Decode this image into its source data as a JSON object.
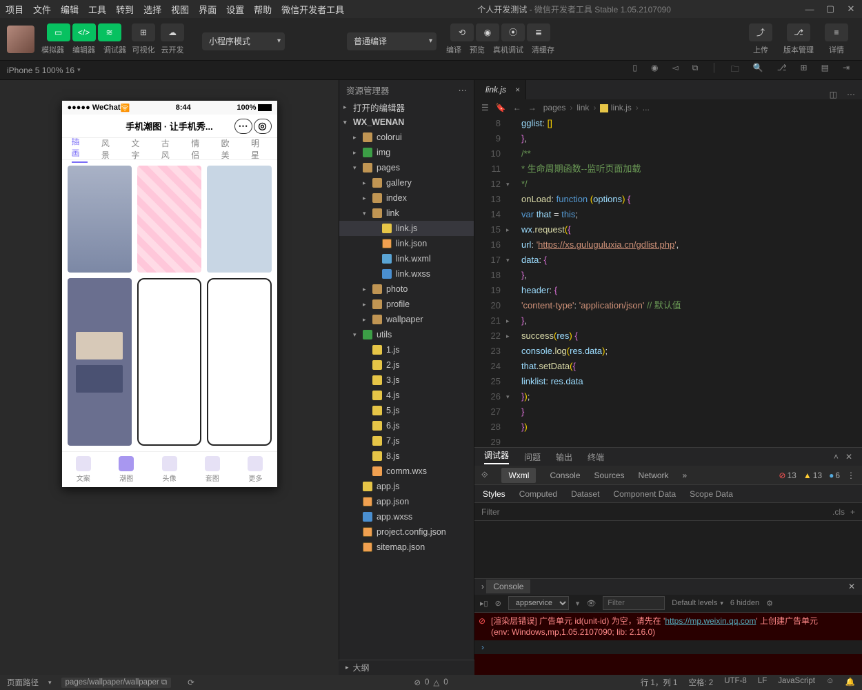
{
  "window": {
    "menus": [
      "项目",
      "文件",
      "编辑",
      "工具",
      "转到",
      "选择",
      "视图",
      "界面",
      "设置",
      "帮助",
      "微信开发者工具"
    ],
    "title_app": "个人开发测试",
    "title_sub": "- 微信开发者工具 Stable 1.05.2107090"
  },
  "toolbar": {
    "mode_labels": [
      "模拟器",
      "编辑器",
      "调试器"
    ],
    "vis_label": "可视化",
    "cloud_label": "云开发",
    "mode_select": "小程序模式",
    "compile_select": "普通编译",
    "action_labels": [
      "编译",
      "预览",
      "真机调试",
      "清缓存"
    ],
    "right_labels": [
      "上传",
      "版本管理",
      "详情"
    ]
  },
  "devbar": {
    "device": "iPhone 5 100% 16"
  },
  "sim": {
    "status": {
      "carrier": "●●●●● WeChat",
      "signal": "",
      "time": "8:44",
      "batt": "100%"
    },
    "title": "手机潮图 · 让手机秀...",
    "tabs": [
      "插画",
      "风景",
      "文字",
      "古风",
      "情侣",
      "欧美",
      "明星"
    ],
    "tabbar": [
      "文案",
      "潮图",
      "头像",
      "套图",
      "更多"
    ]
  },
  "explorer": {
    "header": "资源管理器",
    "sections": {
      "open": "打开的编辑器",
      "project": "WX_WENAN",
      "outline": "大纲"
    },
    "tree": [
      {
        "d": 1,
        "t": "colorui",
        "k": "dir"
      },
      {
        "d": 1,
        "t": "img",
        "k": "dirg"
      },
      {
        "d": 1,
        "t": "pages",
        "k": "dir",
        "open": true
      },
      {
        "d": 2,
        "t": "gallery",
        "k": "dir"
      },
      {
        "d": 2,
        "t": "index",
        "k": "dir"
      },
      {
        "d": 2,
        "t": "link",
        "k": "dir",
        "open": true
      },
      {
        "d": 3,
        "t": "link.js",
        "k": "js",
        "sel": true
      },
      {
        "d": 3,
        "t": "link.json",
        "k": "json"
      },
      {
        "d": 3,
        "t": "link.wxml",
        "k": "wxml"
      },
      {
        "d": 3,
        "t": "link.wxss",
        "k": "wxss"
      },
      {
        "d": 2,
        "t": "photo",
        "k": "dir"
      },
      {
        "d": 2,
        "t": "profile",
        "k": "dir"
      },
      {
        "d": 2,
        "t": "wallpaper",
        "k": "dir"
      },
      {
        "d": 1,
        "t": "utils",
        "k": "dirg",
        "open": true
      },
      {
        "d": 2,
        "t": "1.js",
        "k": "js"
      },
      {
        "d": 2,
        "t": "2.js",
        "k": "js"
      },
      {
        "d": 2,
        "t": "3.js",
        "k": "js"
      },
      {
        "d": 2,
        "t": "4.js",
        "k": "js"
      },
      {
        "d": 2,
        "t": "5.js",
        "k": "js"
      },
      {
        "d": 2,
        "t": "6.js",
        "k": "js"
      },
      {
        "d": 2,
        "t": "7.js",
        "k": "js"
      },
      {
        "d": 2,
        "t": "8.js",
        "k": "js"
      },
      {
        "d": 2,
        "t": "comm.wxs",
        "k": "wxs"
      },
      {
        "d": 1,
        "t": "app.js",
        "k": "js"
      },
      {
        "d": 1,
        "t": "app.json",
        "k": "json"
      },
      {
        "d": 1,
        "t": "app.wxss",
        "k": "wxss"
      },
      {
        "d": 1,
        "t": "project.config.json",
        "k": "json"
      },
      {
        "d": 1,
        "t": "sitemap.json",
        "k": "json"
      }
    ]
  },
  "editor": {
    "tab": "link.js",
    "crumbs": [
      "pages",
      "link",
      "link.js",
      "..."
    ],
    "first_line": 8,
    "folds": {
      "12": "▾",
      "15": "▸",
      "17": "▾",
      "21": "▸",
      "22": "▸",
      "26": "▾"
    },
    "code_html": [
      "    <span class='tok-prop'>gglist</span>: <span class='tok-par'>[</span><span class='tok-par'>]</span>",
      "  <span class='tok-br'>}</span>,",
      "",
      "  <span class='tok-com'>/**</span>",
      "  <span class='tok-com'> * 生命周期函数--监听页面加载</span>",
      "  <span class='tok-com'> */</span>",
      "  <span class='tok-fn'>onLoad</span>: <span class='tok-kw'>function</span> <span class='tok-par'>(</span><span class='tok-var'>options</span><span class='tok-par'>)</span> <span class='tok-br'>{</span>",
      "    <span class='tok-kw'>var</span> <span class='tok-var'>that</span> = <span class='tok-th'>this</span>;",
      "    <span class='tok-var'>wx</span>.<span class='tok-fn'>request</span><span class='tok-par'>(</span><span class='tok-br'>{</span>",
      "      <span class='tok-prop'>url</span>: <span class='tok-strp'>'</span><span class='tok-str'>https://xs.guluguluxia.cn/gdlist.php</span><span class='tok-strp'>'</span>,",
      "      <span class='tok-prop'>data</span>: <span class='tok-br'>{</span>",
      "      <span class='tok-br'>}</span>,",
      "      <span class='tok-prop'>header</span>: <span class='tok-br'>{</span>",
      "        <span class='tok-strp'>'content-type'</span>: <span class='tok-strp'>'application/json'</span> <span class='tok-com'>// 默认值</span>",
      "      <span class='tok-br'>}</span>,",
      "      <span class='tok-fn'>success</span><span class='tok-par'>(</span><span class='tok-var'>res</span><span class='tok-par'>)</span> <span class='tok-br'>{</span>",
      "        <span class='tok-var'>console</span>.<span class='tok-fn'>log</span><span class='tok-par'>(</span><span class='tok-var'>res</span>.<span class='tok-var'>data</span><span class='tok-par'>)</span>;",
      "        <span class='tok-var'>that</span>.<span class='tok-fn'>setData</span><span class='tok-par'>(</span><span class='tok-br'>{</span>",
      "          <span class='tok-prop'>linklist</span>: <span class='tok-var'>res</span>.<span class='tok-var'>data</span>",
      "        <span class='tok-br'>}</span><span class='tok-par'>)</span>;",
      "      <span class='tok-br'>}</span>",
      "    <span class='tok-br'>}</span><span class='tok-par'>)</span>"
    ]
  },
  "debugger": {
    "top_tabs": [
      "调试器",
      "问题",
      "输出",
      "终端"
    ],
    "devtool_tabs": [
      "Wxml",
      "Console",
      "Sources",
      "Network"
    ],
    "err_count": "13",
    "warn_count": "13",
    "info_count": "6",
    "style_tabs": [
      "Styles",
      "Computed",
      "Dataset",
      "Component Data",
      "Scope Data"
    ],
    "filter_ph": "Filter",
    "cls": ".cls",
    "console_tab": "Console",
    "context": "appservice",
    "filter2_ph": "Filter",
    "levels": "Default levels",
    "hidden": "6 hidden",
    "err1": "[渲染层错误] 广告单元 id(unit-id) 为空，请先在 '",
    "err1_link": "https://mp.weixin.qq.com",
    "err1_tail": "' 上创建广告单元",
    "err2": "(env: Windows,mp,1.05.2107090; lib: 2.16.0)"
  },
  "status": {
    "route_lbl": "页面路径",
    "route": "pages/wallpaper/wallpaper",
    "issues": "0",
    "warn": "0",
    "cursor": "行 1，列 1",
    "spaces": "空格: 2",
    "enc": "UTF-8",
    "eol": "LF",
    "lang": "JavaScript"
  }
}
